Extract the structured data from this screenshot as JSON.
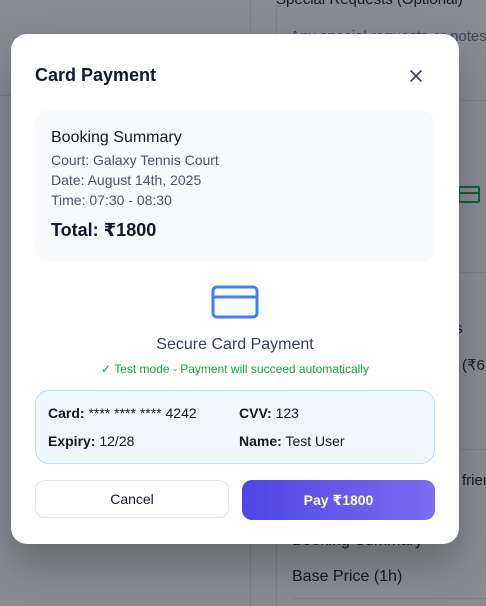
{
  "background": {
    "special_requests_label": "Special Requests (Optional)",
    "notes_snippet": "Any special requests or notes",
    "price_snippet": "(₹6",
    "letter_snippet": "s",
    "friends_snippet": "friends",
    "booking_summary": "Booking Summary",
    "base_price": "Base Price (1h)"
  },
  "modal": {
    "title": "Card Payment",
    "close_icon": "close-icon",
    "summary": {
      "title": "Booking Summary",
      "court": "Court: Galaxy Tennis Court",
      "date": "Date: August 14th, 2025",
      "time": "Time: 07:30 - 08:30",
      "total": "Total: ₹1800"
    },
    "secure_title": "Secure Card Payment",
    "test_note": "✓ Test mode - Payment will succeed automatically",
    "test_card": {
      "card_label": "Card:",
      "card_value": "**** **** **** 4242",
      "cvv_label": "CVV:",
      "cvv_value": "123",
      "expiry_label": "Expiry:",
      "expiry_value": "12/28",
      "name_label": "Name:",
      "name_value": "Test User"
    },
    "cancel_label": "Cancel",
    "pay_label": "Pay ₹1800"
  },
  "colors": {
    "accent": "#4f46e5",
    "success": "#16a34a",
    "card_icon": "#3b82f6"
  }
}
